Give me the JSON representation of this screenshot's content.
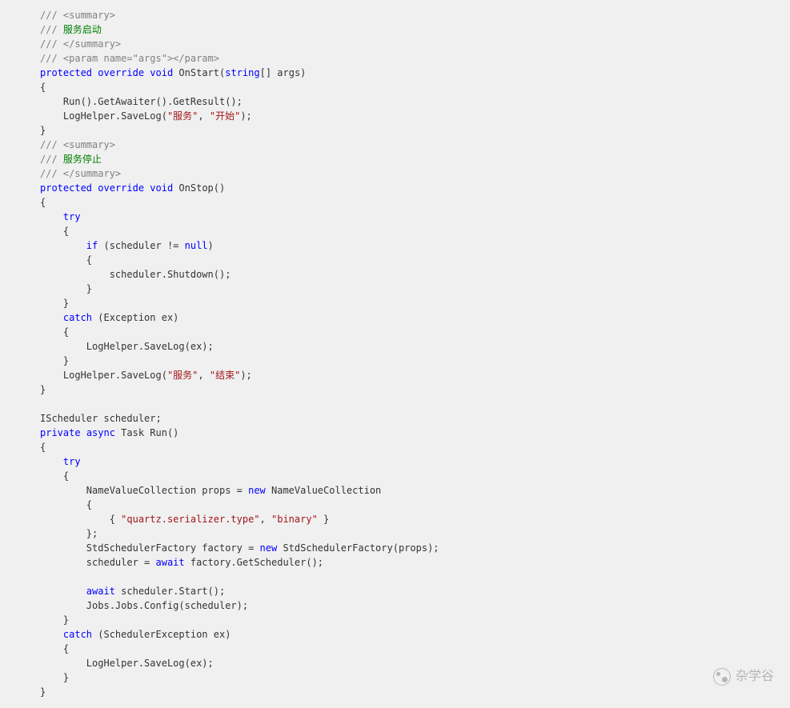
{
  "watermark": {
    "text": "杂学谷"
  },
  "code": {
    "lines": [
      [
        {
          "t": "/// ",
          "c": "c-gray"
        },
        {
          "t": "<summary>",
          "c": "c-gray"
        }
      ],
      [
        {
          "t": "/// ",
          "c": "c-gray"
        },
        {
          "t": "服务启动",
          "c": "c-comment"
        }
      ],
      [
        {
          "t": "/// ",
          "c": "c-gray"
        },
        {
          "t": "</summary>",
          "c": "c-gray"
        }
      ],
      [
        {
          "t": "/// ",
          "c": "c-gray"
        },
        {
          "t": "<param name=\"args\"></param>",
          "c": "c-gray"
        }
      ],
      [
        {
          "t": "protected",
          "c": "c-keyword"
        },
        {
          "t": " "
        },
        {
          "t": "override",
          "c": "c-keyword"
        },
        {
          "t": " "
        },
        {
          "t": "void",
          "c": "c-keyword"
        },
        {
          "t": " OnStart("
        },
        {
          "t": "string",
          "c": "c-keyword"
        },
        {
          "t": "[] args)"
        }
      ],
      [
        {
          "t": "{"
        }
      ],
      [
        {
          "t": "    Run().GetAwaiter().GetResult();"
        }
      ],
      [
        {
          "t": "    LogHelper.SaveLog("
        },
        {
          "t": "\"服务\"",
          "c": "c-string"
        },
        {
          "t": ", "
        },
        {
          "t": "\"开始\"",
          "c": "c-string"
        },
        {
          "t": ");"
        }
      ],
      [
        {
          "t": "}"
        }
      ],
      [
        {
          "t": "/// ",
          "c": "c-gray"
        },
        {
          "t": "<summary>",
          "c": "c-gray"
        }
      ],
      [
        {
          "t": "/// ",
          "c": "c-gray"
        },
        {
          "t": "服务停止",
          "c": "c-comment"
        }
      ],
      [
        {
          "t": "/// ",
          "c": "c-gray"
        },
        {
          "t": "</summary>",
          "c": "c-gray"
        }
      ],
      [
        {
          "t": "protected",
          "c": "c-keyword"
        },
        {
          "t": " "
        },
        {
          "t": "override",
          "c": "c-keyword"
        },
        {
          "t": " "
        },
        {
          "t": "void",
          "c": "c-keyword"
        },
        {
          "t": " OnStop()"
        }
      ],
      [
        {
          "t": "{"
        }
      ],
      [
        {
          "t": "    "
        },
        {
          "t": "try",
          "c": "c-keyword"
        }
      ],
      [
        {
          "t": "    {"
        }
      ],
      [
        {
          "t": "        "
        },
        {
          "t": "if",
          "c": "c-keyword"
        },
        {
          "t": " (scheduler != "
        },
        {
          "t": "null",
          "c": "c-keyword"
        },
        {
          "t": ")"
        }
      ],
      [
        {
          "t": "        {"
        }
      ],
      [
        {
          "t": "            scheduler.Shutdown();"
        }
      ],
      [
        {
          "t": "        }"
        }
      ],
      [
        {
          "t": "    }"
        }
      ],
      [
        {
          "t": "    "
        },
        {
          "t": "catch",
          "c": "c-keyword"
        },
        {
          "t": " (Exception ex)"
        }
      ],
      [
        {
          "t": "    {"
        }
      ],
      [
        {
          "t": "        LogHelper.SaveLog(ex);"
        }
      ],
      [
        {
          "t": "    }"
        }
      ],
      [
        {
          "t": "    LogHelper.SaveLog("
        },
        {
          "t": "\"服务\"",
          "c": "c-string"
        },
        {
          "t": ", "
        },
        {
          "t": "\"结束\"",
          "c": "c-string"
        },
        {
          "t": ");"
        }
      ],
      [
        {
          "t": "}"
        }
      ],
      [
        {
          "t": " "
        }
      ],
      [
        {
          "t": "IScheduler scheduler;"
        }
      ],
      [
        {
          "t": "private",
          "c": "c-keyword"
        },
        {
          "t": " "
        },
        {
          "t": "async",
          "c": "c-keyword"
        },
        {
          "t": " Task Run()"
        }
      ],
      [
        {
          "t": "{"
        }
      ],
      [
        {
          "t": "    "
        },
        {
          "t": "try",
          "c": "c-keyword"
        }
      ],
      [
        {
          "t": "    {"
        }
      ],
      [
        {
          "t": "        NameValueCollection props = "
        },
        {
          "t": "new",
          "c": "c-keyword"
        },
        {
          "t": " NameValueCollection"
        }
      ],
      [
        {
          "t": "        {"
        }
      ],
      [
        {
          "t": "            { "
        },
        {
          "t": "\"quartz.serializer.type\"",
          "c": "c-string"
        },
        {
          "t": ", "
        },
        {
          "t": "\"binary\"",
          "c": "c-string"
        },
        {
          "t": " }"
        }
      ],
      [
        {
          "t": "        };"
        }
      ],
      [
        {
          "t": "        StdSchedulerFactory factory = "
        },
        {
          "t": "new",
          "c": "c-keyword"
        },
        {
          "t": " StdSchedulerFactory(props);"
        }
      ],
      [
        {
          "t": "        scheduler = "
        },
        {
          "t": "await",
          "c": "c-keyword"
        },
        {
          "t": " factory.GetScheduler();"
        }
      ],
      [
        {
          "t": " "
        }
      ],
      [
        {
          "t": "        "
        },
        {
          "t": "await",
          "c": "c-keyword"
        },
        {
          "t": " scheduler.Start();"
        }
      ],
      [
        {
          "t": "        Jobs.Jobs.Config(scheduler);"
        }
      ],
      [
        {
          "t": "    }"
        }
      ],
      [
        {
          "t": "    "
        },
        {
          "t": "catch",
          "c": "c-keyword"
        },
        {
          "t": " (SchedulerException ex)"
        }
      ],
      [
        {
          "t": "    {"
        }
      ],
      [
        {
          "t": "        LogHelper.SaveLog(ex);"
        }
      ],
      [
        {
          "t": "    }"
        }
      ],
      [
        {
          "t": "}"
        }
      ]
    ]
  }
}
